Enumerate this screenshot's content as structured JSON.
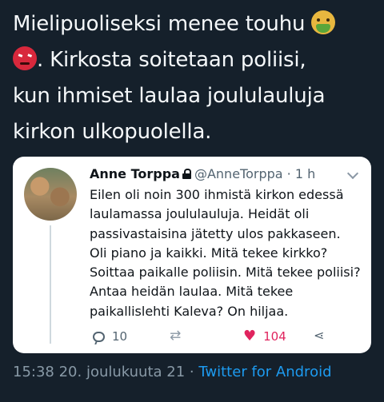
{
  "tweet": {
    "line1": "Mielipuoliseksi menee touhu",
    "line2": ". Kirkosta soitetaan poliisi,",
    "line3": "kun ihmiset laulaa joululauluja",
    "line4": "kirkon ulkopuolella.",
    "emoji1": "sick-face-emoji",
    "emoji2": "angry-face-emoji"
  },
  "quoted": {
    "name": "Anne Torppa",
    "handle": "@AnneTorppa",
    "separator": "·",
    "time": "1 h",
    "body": "Eilen oli noin 300 ihmistä kirkon edessä laulamassa joululauluja. Heidät oli passivastaisina jätetty ulos pakkaseen. Oli piano ja kaikki. Mitä tekee kirkko? Soittaa paikalle poliisin. Mitä tekee poliisi? Antaa heidän laulaa. Mitä tekee paikallislehti Kaleva? On hiljaa.",
    "replies": "10",
    "likes": "104"
  },
  "footer": {
    "timestamp": "15:38 20. joulukuuta 21",
    "separator": "·",
    "source": "Twitter for Android"
  },
  "colors": {
    "background": "#15202b",
    "link": "#1d9bf0",
    "like": "#e0245e"
  }
}
